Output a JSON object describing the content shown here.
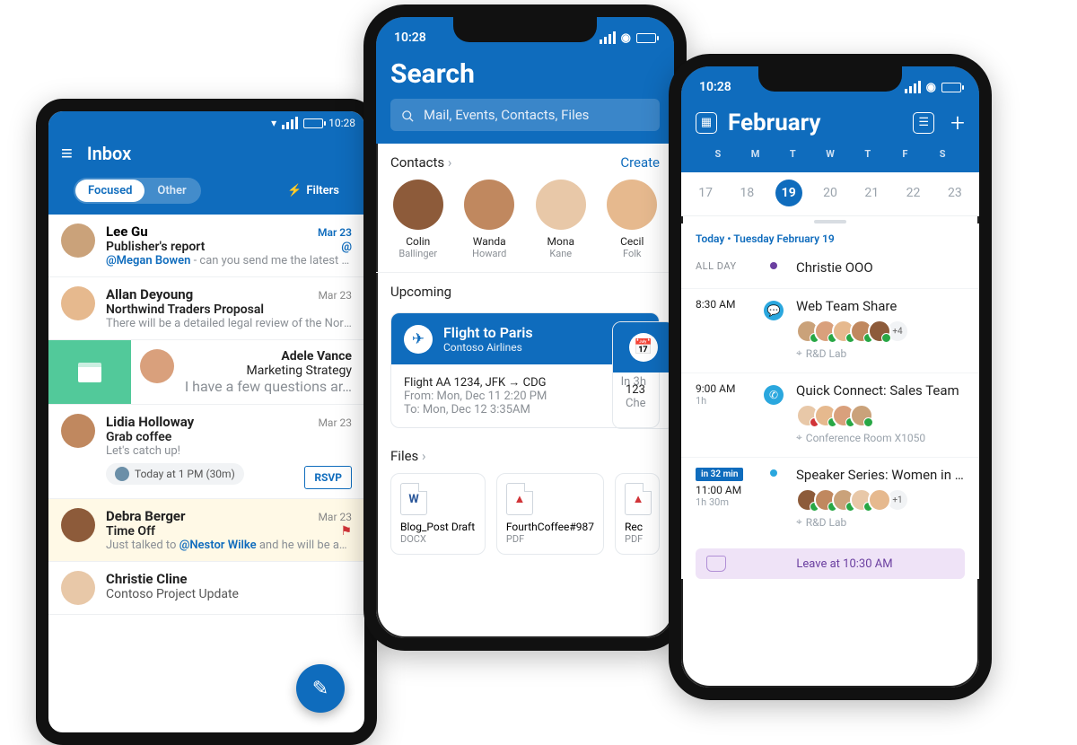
{
  "status": {
    "time_android": "10:28",
    "time_iphone": "10:28"
  },
  "inbox": {
    "title": "Inbox",
    "tab_focused": "Focused",
    "tab_other": "Other",
    "filters_label": "Filters",
    "emails": [
      {
        "sender": "Lee Gu",
        "date": "Mar 23",
        "subject": "Publisher's report",
        "mention": "@Megan Bowen",
        "preview_after_mention": " - can you send me the latest publi…",
        "unread": true
      },
      {
        "sender": "Allan Deyoung",
        "date": "Mar 23",
        "subject": "Northwind Traders Proposal",
        "preview": "There will be a detailed legal review of the Northw…"
      },
      {
        "sender": "Adele Vance",
        "subject": "Marketing Strategy",
        "preview": "I have a few questions ar…",
        "swiped": true
      },
      {
        "sender": "Lidia Holloway",
        "date": "Mar 23",
        "subject": "Grab coffee",
        "preview": "Let's catch up!",
        "rsvp_chip": "Today at 1 PM (30m)",
        "rsvp_button": "RSVP"
      },
      {
        "sender": "Debra Berger",
        "date": "Mar 23",
        "subject": "Time Off",
        "preview_prefix": "Just talked to ",
        "mention": "@Nestor Wilke",
        "preview_after_mention": " and he will be ab…",
        "flagged": true,
        "highlight": true
      },
      {
        "sender": "Christie Cline",
        "subject": "Contoso Project Update"
      }
    ]
  },
  "search": {
    "title": "Search",
    "placeholder": "Mail, Events, Contacts, Files",
    "contacts_header": "Contacts",
    "create_label": "Create",
    "contacts": [
      {
        "first": "Colin",
        "last": "Ballinger"
      },
      {
        "first": "Wanda",
        "last": "Howard"
      },
      {
        "first": "Mona",
        "last": "Kane"
      },
      {
        "first": "Cecil",
        "last": "Folk"
      }
    ],
    "upcoming_header": "Upcoming",
    "upcoming_card": {
      "title": "Flight to Paris",
      "subtitle": "Contoso Airlines",
      "flight_line": "Flight AA 1234, JFK → CDG",
      "eta": "In 3h",
      "from_line": "From: Mon, Dec 11 2:20 PM",
      "to_line": "To: Mon, Dec 12 3:35AM"
    },
    "upcoming_peek": {
      "top": "123",
      "bottom": "Che"
    },
    "files_header": "Files",
    "files": [
      {
        "name": "Blog_Post Draft",
        "ext": "DOCX",
        "kind": "word",
        "letter": "W"
      },
      {
        "name": "FourthCoffee#987",
        "ext": "PDF",
        "kind": "pdf",
        "letter": "▲"
      },
      {
        "name": "Rec",
        "ext": "PDF",
        "kind": "pdf",
        "letter": "▲"
      }
    ]
  },
  "calendar": {
    "title": "February",
    "dow": [
      "S",
      "M",
      "T",
      "W",
      "T",
      "F",
      "S"
    ],
    "days": [
      "17",
      "18",
      "19",
      "20",
      "21",
      "22",
      "23"
    ],
    "selected_index": 2,
    "today_label": "Today • Tuesday February 19",
    "allday_label": "ALL DAY",
    "events": [
      {
        "time": "",
        "allday": true,
        "title": "Christie OOO",
        "dot_color": "#6b3fa0"
      },
      {
        "time": "8:30 AM",
        "title": "Web Team Share",
        "icon": "chat",
        "icon_color": "#2aa7de",
        "faces": 5,
        "more": "+4",
        "location": "R&D Lab"
      },
      {
        "time": "9:00 AM",
        "duration": "1h",
        "title": "Quick Connect: Sales Team",
        "icon": "phone",
        "icon_color": "#2aa7de",
        "faces": 4,
        "location": "Conference Room X1050"
      },
      {
        "time": "11:00 AM",
        "duration": "1h 30m",
        "countdown": "in 32 min",
        "title": "Speaker Series: Women in Adver…",
        "dot_color": "#2aa7de",
        "faces": 5,
        "more": "+1",
        "location": "R&D Lab"
      }
    ],
    "leave_label": "Leave at 10:30 AM"
  }
}
